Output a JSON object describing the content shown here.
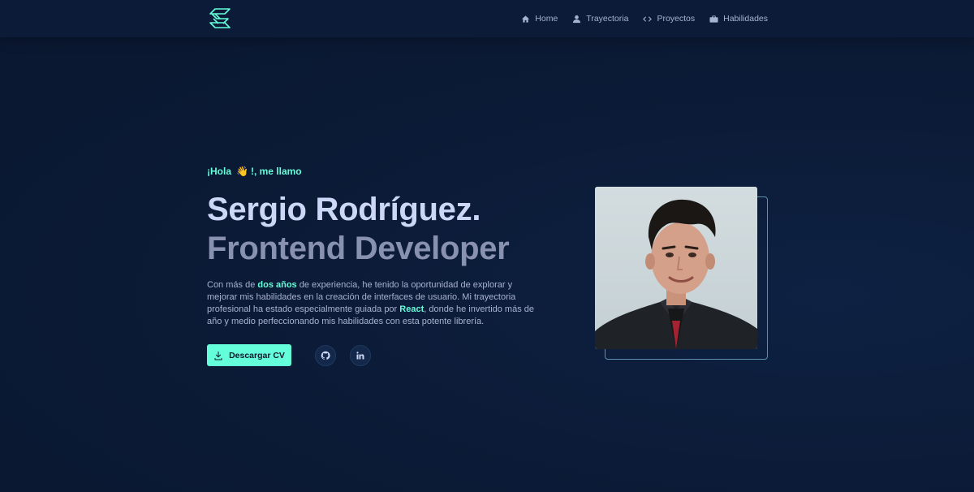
{
  "nav": {
    "logo": "logo-icon",
    "items": [
      {
        "label": "Home",
        "icon": "home-icon"
      },
      {
        "label": "Trayectoria",
        "icon": "user-icon"
      },
      {
        "label": "Proyectos",
        "icon": "code-icon"
      },
      {
        "label": "Habilidades",
        "icon": "briefcase-icon"
      }
    ]
  },
  "hero": {
    "greeting_pre": "¡Hola",
    "greeting_emoji": "👋",
    "greeting_post": "!, me llamo",
    "name": "Sergio Rodríguez.",
    "role": "Frontend Developer",
    "bio": {
      "p1": "Con más de ",
      "h1": "dos años",
      "p2": " de experiencia, he tenido la oportunidad de explorar y mejorar mis habilidades en la creación de interfaces de usuario. Mi trayectoria profesional ha estado especialmente guiada por ",
      "h2": "React",
      "p3": ", donde he invertido más de año y medio perfeccionando mis habilidades con esta potente librería."
    },
    "cv_button": "Descargar CV",
    "social": [
      "github-icon",
      "linkedin-icon"
    ]
  },
  "colors": {
    "accent": "#64ffda",
    "background": "#0b1a35",
    "heading": "#ccd6f6",
    "subheading": "#8892b0"
  }
}
